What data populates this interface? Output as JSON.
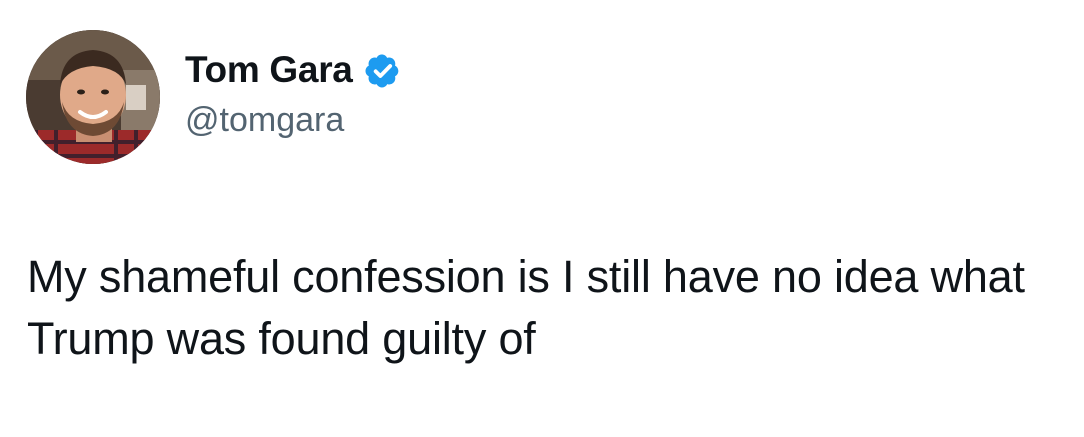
{
  "author": {
    "display_name": "Tom Gara",
    "handle": "@tomgara",
    "verified_badge_icon": "verified-badge-icon",
    "badge_color": "#1d9bf0"
  },
  "tweet": {
    "text": "My shameful confession is I still have no idea what Trump was found guilty of"
  },
  "colors": {
    "text_primary": "#0f1419",
    "text_secondary": "#536471",
    "background": "#ffffff"
  }
}
